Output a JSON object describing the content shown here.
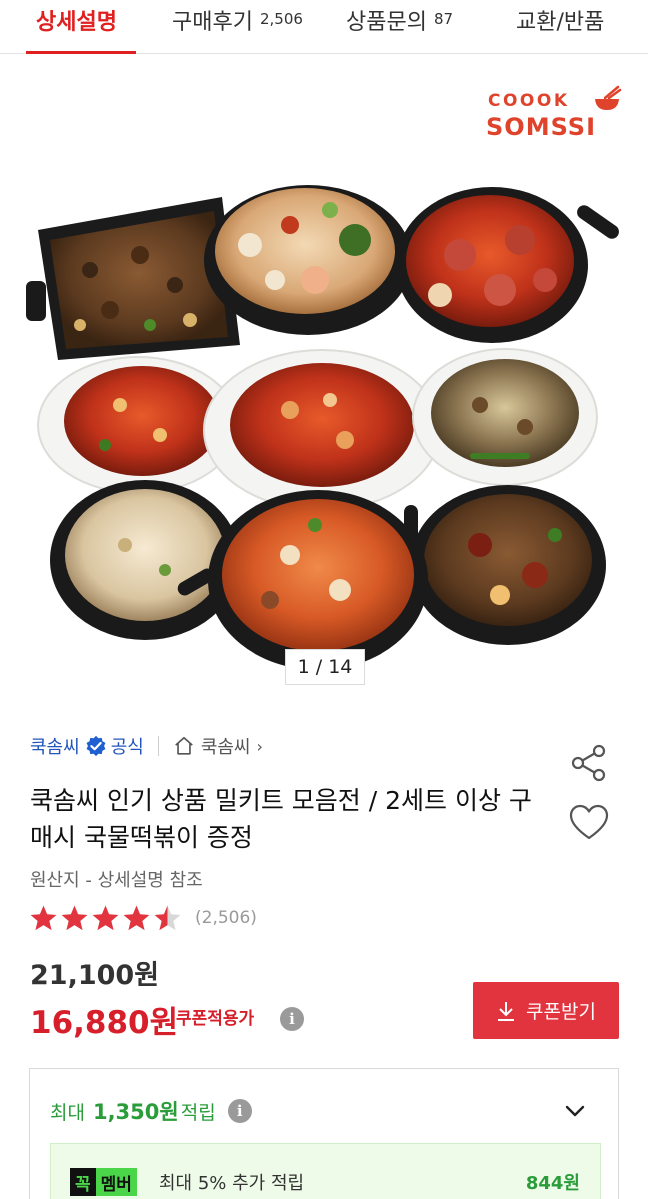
{
  "tabs": [
    {
      "label": "상세설명",
      "count": ""
    },
    {
      "label": "구매후기",
      "count": "2,506"
    },
    {
      "label": "상품문의",
      "count": "87"
    },
    {
      "label": "교환/반품",
      "count": ""
    }
  ],
  "brand": {
    "line1": "COOOK",
    "line2": "SOMSSI"
  },
  "gallery": {
    "pager": "1 / 14"
  },
  "seller": {
    "name": "쿡솜씨",
    "badge_label": "공식",
    "store_link": "쿡솜씨"
  },
  "product": {
    "title": "쿡솜씨 인기 상품 밀키트 모음전 / 2세트 이상 구매시 국물떡볶이 증정",
    "origin": "원산지 - 상세설명 참조",
    "rating_value": 4.5,
    "review_count": "(2,506)",
    "price_original": "21,100원",
    "price_sale": "16,880원",
    "coupon_note": "쿠폰적용가",
    "coupon_button": "쿠폰받기"
  },
  "points": {
    "prefix": "최대",
    "amount": "1,350원",
    "suffix": "적립",
    "member_badge_a": "꼭",
    "member_badge_b": "멤버",
    "member_text": "최대 5% 추가 적립",
    "member_points": "844원"
  },
  "icons": [
    "verified-badge-icon",
    "home-icon",
    "chevron-right-icon",
    "share-icon",
    "heart-icon",
    "star-icon",
    "info-icon",
    "download-icon",
    "chevron-down-icon"
  ],
  "colors": {
    "accent": "#e02020",
    "sale": "#d71f2b",
    "seller_link": "#2255bb",
    "points_green": "#2a9d3a",
    "star": "#e2343f"
  }
}
